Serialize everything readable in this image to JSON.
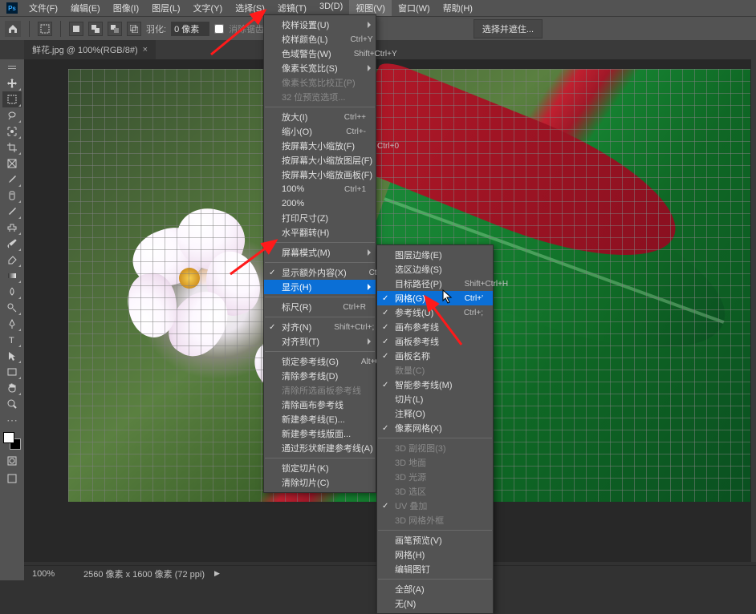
{
  "app": {
    "logo": "Ps"
  },
  "menubar": {
    "items": [
      "文件(F)",
      "编辑(E)",
      "图像(I)",
      "图层(L)",
      "文字(Y)",
      "选择(S)",
      "滤镜(T)",
      "3D(D)",
      "视图(V)",
      "窗口(W)",
      "帮助(H)"
    ],
    "open_index": 8
  },
  "optionsbar": {
    "tool_hint": "□",
    "feather_label": "羽化:",
    "feather_value": "0 像素",
    "anti_alias": "消除锯齿",
    "ellipsis": "……",
    "select_mask_btn": "选择并遮住..."
  },
  "document": {
    "tab_title": "鲜花.jpg @ 100%(RGB/8#)",
    "zoom": "100%",
    "dims": "2560 像素 x 1600 像素 (72 ppi)"
  },
  "view_menu": {
    "items": [
      {
        "label": "校样设置(U)",
        "sub": true
      },
      {
        "label": "校样颜色(L)",
        "shortcut": "Ctrl+Y"
      },
      {
        "label": "色域警告(W)",
        "shortcut": "Shift+Ctrl+Y"
      },
      {
        "label": "像素长宽比(S)",
        "sub": true
      },
      {
        "label": "像素长宽比校正(P)",
        "disabled": true
      },
      {
        "label": "32 位预览选项...",
        "disabled": true
      },
      {
        "sep": true
      },
      {
        "label": "放大(I)",
        "shortcut": "Ctrl++"
      },
      {
        "label": "缩小(O)",
        "shortcut": "Ctrl+-"
      },
      {
        "label": "按屏幕大小缩放(F)",
        "shortcut": "Ctrl+0"
      },
      {
        "label": "按屏幕大小缩放图层(F)"
      },
      {
        "label": "按屏幕大小缩放画板(F)"
      },
      {
        "label": "100%",
        "shortcut": "Ctrl+1"
      },
      {
        "label": "200%"
      },
      {
        "label": "打印尺寸(Z)"
      },
      {
        "label": "水平翻转(H)"
      },
      {
        "sep": true
      },
      {
        "label": "屏幕模式(M)",
        "sub": true
      },
      {
        "sep": true
      },
      {
        "label": "显示额外内容(X)",
        "shortcut": "Ctrl+H",
        "check": true
      },
      {
        "label": "显示(H)",
        "sub": true,
        "highlight": true
      },
      {
        "sep": true
      },
      {
        "label": "标尺(R)",
        "shortcut": "Ctrl+R"
      },
      {
        "sep": true
      },
      {
        "label": "对齐(N)",
        "shortcut": "Shift+Ctrl+;",
        "check": true
      },
      {
        "label": "对齐到(T)",
        "sub": true
      },
      {
        "sep": true
      },
      {
        "label": "锁定参考线(G)",
        "shortcut": "Alt+Ctrl+;"
      },
      {
        "label": "清除参考线(D)"
      },
      {
        "label": "清除所选画板参考线",
        "disabled": true
      },
      {
        "label": "清除画布参考线"
      },
      {
        "label": "新建参考线(E)..."
      },
      {
        "label": "新建参考线版面..."
      },
      {
        "label": "通过形状新建参考线(A)"
      },
      {
        "sep": true
      },
      {
        "label": "锁定切片(K)"
      },
      {
        "label": "清除切片(C)"
      }
    ]
  },
  "sub_menu": {
    "items": [
      {
        "label": "图层边缘(E)"
      },
      {
        "label": "选区边缘(S)"
      },
      {
        "label": "目标路径(P)",
        "shortcut": "Shift+Ctrl+H"
      },
      {
        "label": "网格(G)",
        "shortcut": "Ctrl+'",
        "highlight": true,
        "check": true
      },
      {
        "label": "参考线(U)",
        "shortcut": "Ctrl+;",
        "check": true
      },
      {
        "label": "画布参考线",
        "check": true
      },
      {
        "label": "画板参考线",
        "check": true
      },
      {
        "label": "画板名称",
        "check": true
      },
      {
        "label": "数量(C)",
        "disabled": true
      },
      {
        "label": "智能参考线(M)",
        "check": true
      },
      {
        "label": "切片(L)"
      },
      {
        "label": "注释(O)"
      },
      {
        "label": "像素网格(X)",
        "check": true
      },
      {
        "sep": true
      },
      {
        "label": "3D 副视图(3)",
        "disabled": true
      },
      {
        "label": "3D 地面",
        "disabled": true
      },
      {
        "label": "3D 光源",
        "disabled": true
      },
      {
        "label": "3D 选区",
        "disabled": true
      },
      {
        "label": "UV 叠加",
        "check": true,
        "disabled": true
      },
      {
        "label": "3D 网格外框",
        "disabled": true
      },
      {
        "sep": true
      },
      {
        "label": "画笔预览(V)"
      },
      {
        "label": "网格(H)"
      },
      {
        "label": "编辑图钉"
      },
      {
        "sep": true
      },
      {
        "label": "全部(A)"
      },
      {
        "label": "无(N)"
      }
    ]
  },
  "colors": {
    "highlight": "#0b6fd6",
    "arrow": "#ff1a1a"
  }
}
